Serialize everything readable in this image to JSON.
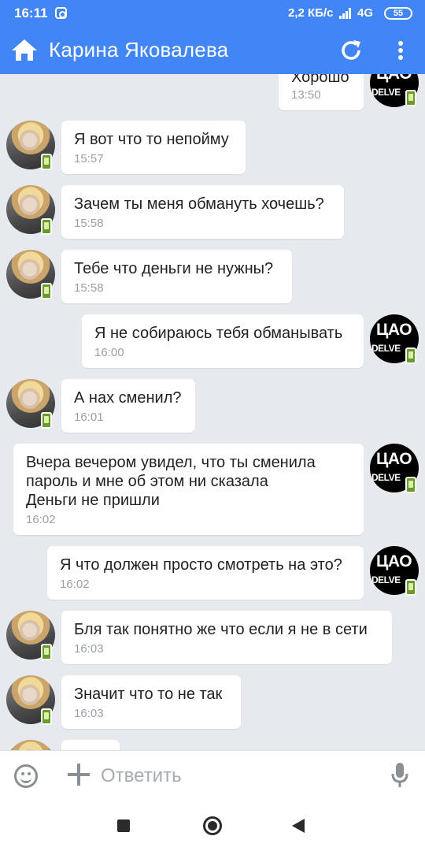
{
  "status_bar": {
    "time": "16:11",
    "network_speed": "2,2 КБ/с",
    "network_type": "4G",
    "battery": "55"
  },
  "header": {
    "title": "Карина Яковалева"
  },
  "avatar_cao": {
    "line1": "ЦАО",
    "line2": "DELVE"
  },
  "messages": [
    {
      "text": "Хорошо",
      "time": "13:50"
    },
    {
      "text": "Я вот что то непойму",
      "time": "15:57"
    },
    {
      "text": "Зачем ты меня обмануть хочешь?",
      "time": "15:58"
    },
    {
      "text": "Тебе что деньги не нужны?",
      "time": "15:58"
    },
    {
      "text": "Я не собираюсь тебя обманывать",
      "time": "16:00"
    },
    {
      "text": "А нах сменил?",
      "time": "16:01"
    },
    {
      "text": "Вчера вечером увидел, что ты сменила\nпароль и мне об этом ни сказала\nДеньги не пришли",
      "time": "16:02"
    },
    {
      "text": "Я что должен просто смотреть на это?",
      "time": "16:02"
    },
    {
      "text": "Бля так понятно же что если я не в сети",
      "time": "16:03"
    },
    {
      "text": "Значит что то не так",
      "time": "16:03"
    }
  ],
  "input": {
    "placeholder": "Ответить"
  },
  "colors": {
    "accent": "#4285f4",
    "background": "#e6eaef",
    "bubble": "#ffffff",
    "online_badge": "#6a9a2a"
  },
  "icons": {
    "home": "home-icon",
    "refresh": "refresh-icon",
    "menu": "more-vert-icon",
    "emoji": "smile-icon",
    "attach": "plus-icon",
    "voice": "mic-icon"
  }
}
